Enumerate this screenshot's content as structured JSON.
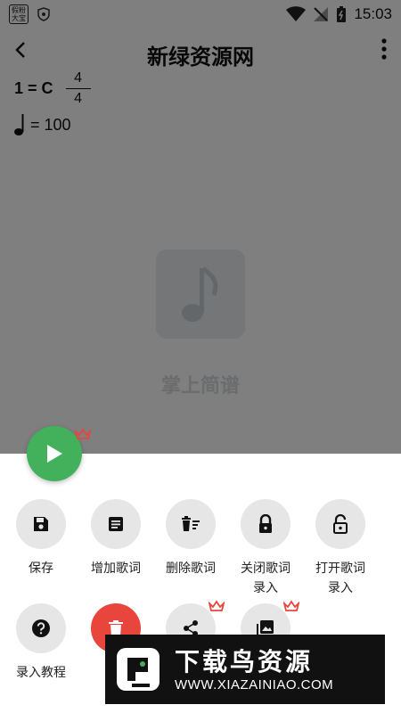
{
  "statusbar": {
    "app_badge": "假粉\n大宝",
    "time": "15:03"
  },
  "appbar": {
    "title": "新绿资源网"
  },
  "score": {
    "key": "1 = C",
    "time_sig_top": "4",
    "time_sig_bottom": "4",
    "tempo": "= 100"
  },
  "empty_state": {
    "label": "掌上简谱"
  },
  "actions": [
    {
      "label": "保存",
      "icon": "save-icon"
    },
    {
      "label": "增加歌词",
      "icon": "add-lyrics-icon"
    },
    {
      "label": "删除歌词",
      "icon": "delete-lyrics-icon"
    },
    {
      "label": "关闭歌词录入",
      "label_line1": "关闭歌词",
      "label_line2": "录入",
      "icon": "lock-icon"
    },
    {
      "label": "打开歌词录入",
      "label_line1": "打开歌词",
      "label_line2": "录入",
      "icon": "unlock-icon"
    },
    {
      "label": "录入教程",
      "icon": "help-icon"
    },
    {
      "label": "",
      "icon": "trash-icon"
    },
    {
      "label": "",
      "icon": "share-icon"
    },
    {
      "label": "",
      "icon": "image-icon"
    }
  ],
  "watermark": {
    "title": "下载鸟资源",
    "url": "WWW.XIAZAINIAO.COM"
  },
  "colors": {
    "play": "#43b05c",
    "delete": "#e8453c",
    "crown": "#e8453c"
  }
}
